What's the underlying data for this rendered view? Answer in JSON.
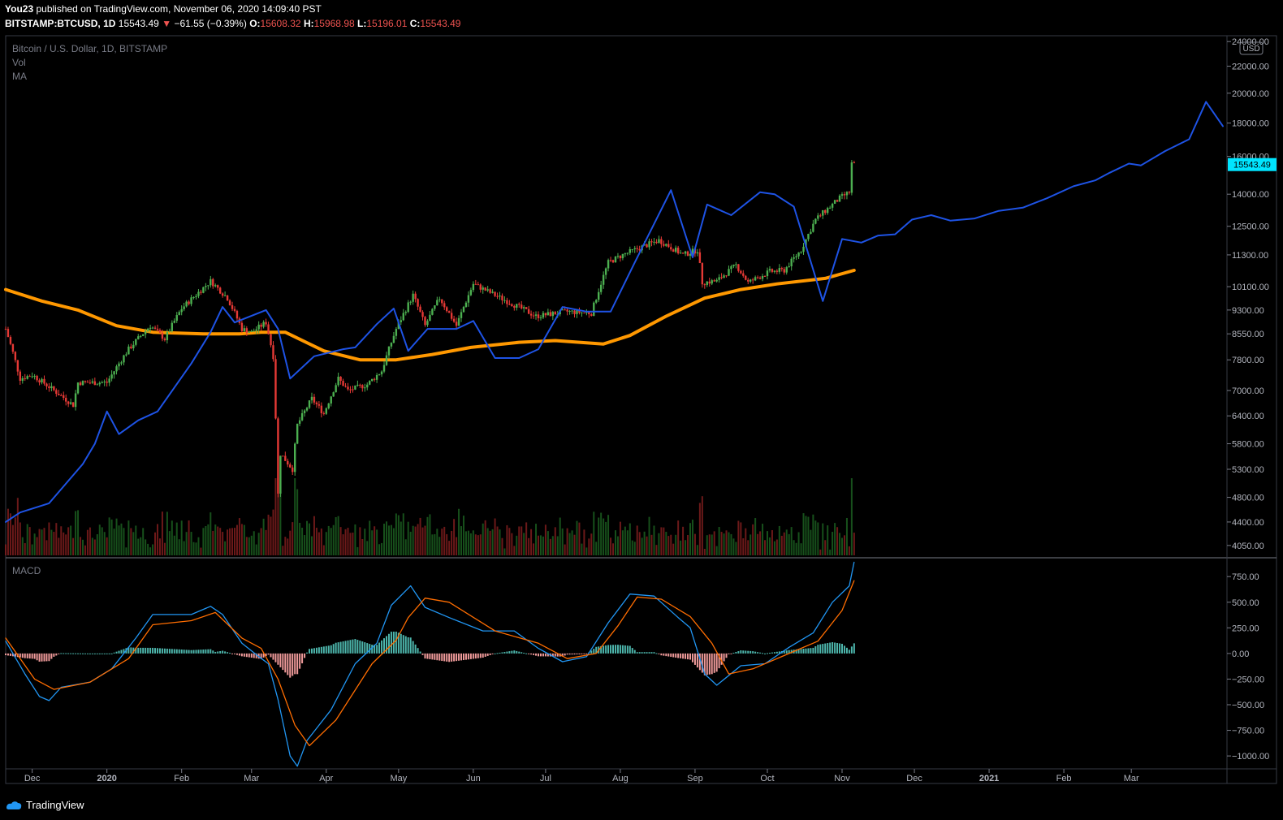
{
  "header": {
    "author": "You23",
    "published": "published on TradingView.com, November 06, 2020 14:09:40 PST",
    "symbol": "BITSTAMP:BTCUSD, 1D",
    "last": "15543.49",
    "change": "−61.55 (−0.39%)",
    "o_label": "O:",
    "o": "15608.32",
    "h_label": "H:",
    "h": "15968.98",
    "l_label": "L:",
    "l": "15196.01",
    "c_label": "C:",
    "c": "15543.49"
  },
  "legend": {
    "title": "Bitcoin / U.S. Dollar, 1D, BITSTAMP",
    "vol": "Vol",
    "ma": "MA"
  },
  "macd_label": "MACD",
  "currency_badge": "USD",
  "price_label": "15543.49",
  "footer": {
    "brand": "TradingView"
  },
  "colors": {
    "up": "#4caf50",
    "down": "#e53935",
    "ma": "#ff9800",
    "projection": "#1e53e5",
    "macd": "#2196f3",
    "signal": "#ff6d00",
    "hist_up": "#4db6ac",
    "hist_down": "#ef9a9a",
    "price_tag": "#00e5ff"
  },
  "chart_data": [
    {
      "type": "candlestick",
      "title": "Bitcoin / U.S. Dollar, 1D, BITSTAMP",
      "y_scale": "log",
      "ylim": [
        3900,
        24500
      ],
      "y_ticks": [
        "24000.00",
        "22000.00",
        "20000.00",
        "18000.00",
        "16000.00",
        "14000.00",
        "12500.00",
        "11300.00",
        "10100.00",
        "9300.00",
        "8550.00",
        "7800.00",
        "7000.00",
        "6400.00",
        "5800.00",
        "5300.00",
        "4800.00",
        "4400.00",
        "4050.00"
      ],
      "x_ticks": [
        "Dec",
        "2020",
        "Feb",
        "Mar",
        "Apr",
        "May",
        "Jun",
        "Jul",
        "Aug",
        "Sep",
        "Oct",
        "Nov",
        "Dec",
        "2021",
        "Feb",
        "Mar"
      ],
      "x_range": [
        "2019-11-20",
        "2021-04-08"
      ],
      "price_keypoints": [
        [
          "2019-11-20",
          8700
        ],
        [
          "2019-11-26",
          7300
        ],
        [
          "2019-12-01",
          7400
        ],
        [
          "2019-12-18",
          6650
        ],
        [
          "2019-12-20",
          7200
        ],
        [
          "2020-01-01",
          7200
        ],
        [
          "2020-01-10",
          8100
        ],
        [
          "2020-01-19",
          8800
        ],
        [
          "2020-01-25",
          8400
        ],
        [
          "2020-02-01",
          9350
        ],
        [
          "2020-02-08",
          9900
        ],
        [
          "2020-02-13",
          10300
        ],
        [
          "2020-02-20",
          9700
        ],
        [
          "2020-02-26",
          8700
        ],
        [
          "2020-03-01",
          8600
        ],
        [
          "2020-03-07",
          8900
        ],
        [
          "2020-03-10",
          7900
        ],
        [
          "2020-03-12",
          4850
        ],
        [
          "2020-03-13",
          5600
        ],
        [
          "2020-03-18",
          5300
        ],
        [
          "2020-03-20",
          6200
        ],
        [
          "2020-03-26",
          6800
        ],
        [
          "2020-03-31",
          6450
        ],
        [
          "2020-04-06",
          7300
        ],
        [
          "2020-04-10",
          7000
        ],
        [
          "2020-04-18",
          7150
        ],
        [
          "2020-04-24",
          7500
        ],
        [
          "2020-04-30",
          8700
        ],
        [
          "2020-05-07",
          9800
        ],
        [
          "2020-05-12",
          8800
        ],
        [
          "2020-05-18",
          9700
        ],
        [
          "2020-05-25",
          8800
        ],
        [
          "2020-06-01",
          10200
        ],
        [
          "2020-06-10",
          9800
        ],
        [
          "2020-06-27",
          9100
        ],
        [
          "2020-07-10",
          9250
        ],
        [
          "2020-07-20",
          9200
        ],
        [
          "2020-07-27",
          11000
        ],
        [
          "2020-08-02",
          11300
        ],
        [
          "2020-08-17",
          11900
        ],
        [
          "2020-08-27",
          11300
        ],
        [
          "2020-09-02",
          11500
        ],
        [
          "2020-09-04",
          10250
        ],
        [
          "2020-09-10",
          10300
        ],
        [
          "2020-09-18",
          10900
        ],
        [
          "2020-09-23",
          10250
        ],
        [
          "2020-10-02",
          10650
        ],
        [
          "2020-10-08",
          10700
        ],
        [
          "2020-10-15",
          11500
        ],
        [
          "2020-10-21",
          12800
        ],
        [
          "2020-10-31",
          13800
        ],
        [
          "2020-11-04",
          14100
        ],
        [
          "2020-11-05",
          15600
        ],
        [
          "2020-11-06",
          15543.49
        ]
      ],
      "ma_series": {
        "name": "MA",
        "points": [
          [
            "2019-11-20",
            10000
          ],
          [
            "2019-12-05",
            9600
          ],
          [
            "2019-12-20",
            9300
          ],
          [
            "2020-01-05",
            8800
          ],
          [
            "2020-01-20",
            8600
          ],
          [
            "2020-02-10",
            8550
          ],
          [
            "2020-02-25",
            8550
          ],
          [
            "2020-03-05",
            8600
          ],
          [
            "2020-03-15",
            8600
          ],
          [
            "2020-03-31",
            8050
          ],
          [
            "2020-04-15",
            7800
          ],
          [
            "2020-04-30",
            7800
          ],
          [
            "2020-05-15",
            7950
          ],
          [
            "2020-05-31",
            8150
          ],
          [
            "2020-06-20",
            8300
          ],
          [
            "2020-07-05",
            8350
          ],
          [
            "2020-07-25",
            8250
          ],
          [
            "2020-08-05",
            8500
          ],
          [
            "2020-08-20",
            9100
          ],
          [
            "2020-09-05",
            9700
          ],
          [
            "2020-09-20",
            10000
          ],
          [
            "2020-10-05",
            10200
          ],
          [
            "2020-10-25",
            10400
          ],
          [
            "2020-11-06",
            10700
          ]
        ]
      },
      "projection_series": {
        "points": [
          [
            "2019-11-20",
            4400
          ],
          [
            "2019-11-26",
            4550
          ],
          [
            "2019-12-08",
            4700
          ],
          [
            "2019-12-22",
            5400
          ],
          [
            "2019-12-27",
            5800
          ],
          [
            "2020-01-01",
            6500
          ],
          [
            "2020-01-06",
            6000
          ],
          [
            "2020-01-14",
            6300
          ],
          [
            "2020-01-22",
            6500
          ],
          [
            "2020-02-05",
            7700
          ],
          [
            "2020-02-13",
            8600
          ],
          [
            "2020-02-18",
            9400
          ],
          [
            "2020-02-23",
            8900
          ],
          [
            "2020-03-07",
            9300
          ],
          [
            "2020-03-12",
            8700
          ],
          [
            "2020-03-17",
            7300
          ],
          [
            "2020-03-27",
            7900
          ],
          [
            "2020-04-08",
            8100
          ],
          [
            "2020-04-13",
            8150
          ],
          [
            "2020-04-22",
            8850
          ],
          [
            "2020-04-29",
            9350
          ],
          [
            "2020-05-05",
            8050
          ],
          [
            "2020-05-13",
            8700
          ],
          [
            "2020-05-25",
            8700
          ],
          [
            "2020-06-01",
            8950
          ],
          [
            "2020-06-10",
            7850
          ],
          [
            "2020-06-20",
            7850
          ],
          [
            "2020-06-28",
            8100
          ],
          [
            "2020-07-08",
            9400
          ],
          [
            "2020-07-18",
            9250
          ],
          [
            "2020-07-28",
            9250
          ],
          [
            "2020-08-07",
            11000
          ],
          [
            "2020-08-22",
            14200
          ],
          [
            "2020-08-31",
            11200
          ],
          [
            "2020-09-06",
            13500
          ],
          [
            "2020-09-16",
            13000
          ],
          [
            "2020-09-28",
            14100
          ],
          [
            "2020-10-04",
            14000
          ],
          [
            "2020-10-12",
            13400
          ],
          [
            "2020-10-24",
            9600
          ],
          [
            "2020-11-01",
            11950
          ],
          [
            "2020-11-09",
            11800
          ],
          [
            "2020-11-16",
            12100
          ],
          [
            "2020-11-23",
            12150
          ],
          [
            "2020-11-30",
            12800
          ],
          [
            "2020-12-08",
            13000
          ],
          [
            "2020-12-16",
            12750
          ],
          [
            "2020-12-26",
            12850
          ],
          [
            "2021-01-05",
            13200
          ],
          [
            "2021-01-15",
            13350
          ],
          [
            "2021-01-25",
            13800
          ],
          [
            "2021-02-05",
            14400
          ],
          [
            "2021-02-14",
            14700
          ],
          [
            "2021-02-20",
            15100
          ],
          [
            "2021-02-28",
            15600
          ],
          [
            "2021-03-05",
            15500
          ],
          [
            "2021-03-15",
            16300
          ],
          [
            "2021-03-25",
            17000
          ],
          [
            "2021-04-01",
            19400
          ],
          [
            "2021-04-08",
            17800
          ]
        ]
      }
    },
    {
      "type": "macd",
      "title": "MACD",
      "ylim": [
        -1110,
        910
      ],
      "y_ticks": [
        "750.00",
        "500.00",
        "250.00",
        "0.00",
        "−250.00",
        "−500.00",
        "−750.00",
        "−1000.00"
      ],
      "macd_keypoints": [
        [
          "2019-11-20",
          120
        ],
        [
          "2019-11-28",
          -200
        ],
        [
          "2019-12-04",
          -420
        ],
        [
          "2019-12-08",
          -460
        ],
        [
          "2019-12-13",
          -330
        ],
        [
          "2019-12-25",
          -280
        ],
        [
          "2020-01-03",
          -150
        ],
        [
          "2020-01-13",
          150
        ],
        [
          "2020-01-20",
          380
        ],
        [
          "2020-01-26",
          380
        ],
        [
          "2020-02-05",
          380
        ],
        [
          "2020-02-13",
          460
        ],
        [
          "2020-02-18",
          380
        ],
        [
          "2020-02-26",
          100
        ],
        [
          "2020-03-04",
          -30
        ],
        [
          "2020-03-08",
          -100
        ],
        [
          "2020-03-12",
          -450
        ],
        [
          "2020-03-17",
          -1000
        ],
        [
          "2020-03-20",
          -1100
        ],
        [
          "2020-03-24",
          -850
        ],
        [
          "2020-04-03",
          -550
        ],
        [
          "2020-04-13",
          -100
        ],
        [
          "2020-04-22",
          100
        ],
        [
          "2020-04-28",
          470
        ],
        [
          "2020-05-06",
          660
        ],
        [
          "2020-05-12",
          450
        ],
        [
          "2020-05-22",
          350
        ],
        [
          "2020-06-05",
          220
        ],
        [
          "2020-06-18",
          220
        ],
        [
          "2020-06-28",
          50
        ],
        [
          "2020-07-08",
          -80
        ],
        [
          "2020-07-18",
          -30
        ],
        [
          "2020-07-27",
          300
        ],
        [
          "2020-08-05",
          580
        ],
        [
          "2020-08-15",
          560
        ],
        [
          "2020-08-25",
          350
        ],
        [
          "2020-08-30",
          250
        ],
        [
          "2020-09-05",
          -200
        ],
        [
          "2020-09-10",
          -310
        ],
        [
          "2020-09-20",
          -120
        ],
        [
          "2020-09-30",
          -100
        ],
        [
          "2020-10-10",
          60
        ],
        [
          "2020-10-20",
          200
        ],
        [
          "2020-10-28",
          500
        ],
        [
          "2020-11-04",
          660
        ],
        [
          "2020-11-06",
          890
        ]
      ],
      "signal_keypoints": [
        [
          "2019-11-20",
          150
        ],
        [
          "2019-12-02",
          -250
        ],
        [
          "2019-12-10",
          -350
        ],
        [
          "2019-12-25",
          -280
        ],
        [
          "2020-01-10",
          -50
        ],
        [
          "2020-01-20",
          280
        ],
        [
          "2020-02-05",
          320
        ],
        [
          "2020-02-15",
          400
        ],
        [
          "2020-02-26",
          150
        ],
        [
          "2020-03-05",
          50
        ],
        [
          "2020-03-12",
          -250
        ],
        [
          "2020-03-19",
          -700
        ],
        [
          "2020-03-25",
          -900
        ],
        [
          "2020-04-05",
          -650
        ],
        [
          "2020-04-20",
          -100
        ],
        [
          "2020-04-30",
          130
        ],
        [
          "2020-05-05",
          350
        ],
        [
          "2020-05-12",
          540
        ],
        [
          "2020-05-22",
          500
        ],
        [
          "2020-06-10",
          220
        ],
        [
          "2020-06-28",
          100
        ],
        [
          "2020-07-10",
          -50
        ],
        [
          "2020-07-22",
          0
        ],
        [
          "2020-07-31",
          270
        ],
        [
          "2020-08-08",
          550
        ],
        [
          "2020-08-18",
          530
        ],
        [
          "2020-08-30",
          360
        ],
        [
          "2020-09-08",
          100
        ],
        [
          "2020-09-15",
          -200
        ],
        [
          "2020-09-25",
          -150
        ],
        [
          "2020-10-10",
          0
        ],
        [
          "2020-10-22",
          120
        ],
        [
          "2020-11-01",
          420
        ],
        [
          "2020-11-06",
          710
        ]
      ]
    }
  ]
}
